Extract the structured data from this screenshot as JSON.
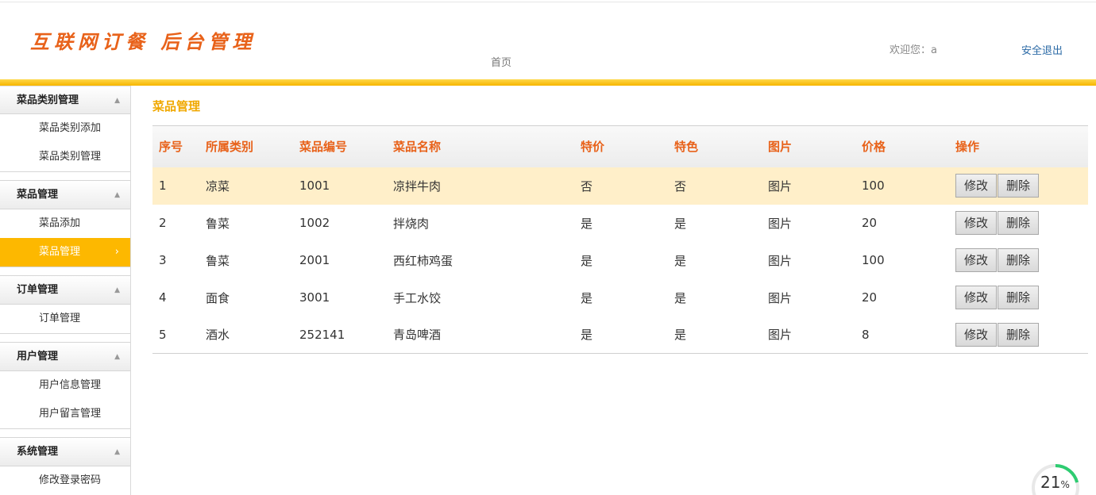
{
  "header": {
    "logo_text": "互联网订餐  后台管理",
    "home_link": "首页",
    "welcome_text": "欢迎您：a",
    "logout_label": "安全退出"
  },
  "sidebar": {
    "groups": [
      {
        "title": "菜品类别管理",
        "items": [
          "菜品类别添加",
          "菜品类别管理"
        ]
      },
      {
        "title": "菜品管理",
        "items": [
          "菜品添加",
          "菜品管理"
        ]
      },
      {
        "title": "订单管理",
        "items": [
          "订单管理"
        ]
      },
      {
        "title": "用户管理",
        "items": [
          "用户信息管理",
          "用户留言管理"
        ]
      },
      {
        "title": "系统管理",
        "items": [
          "修改登录密码"
        ]
      }
    ],
    "active_item": "菜品管理"
  },
  "main": {
    "title": "菜品管理",
    "columns": [
      "序号",
      "所属类别",
      "菜品编号",
      "菜品名称",
      "特价",
      "特色",
      "图片",
      "价格",
      "操作"
    ],
    "rows": [
      {
        "no": "1",
        "category": "凉菜",
        "code": "1001",
        "name": "凉拌牛肉",
        "special_price": "否",
        "featured": "否",
        "image": "图片",
        "price": "100"
      },
      {
        "no": "2",
        "category": "鲁菜",
        "code": "1002",
        "name": "拌烧肉",
        "special_price": "是",
        "featured": "是",
        "image": "图片",
        "price": "20"
      },
      {
        "no": "3",
        "category": "鲁菜",
        "code": "2001",
        "name": "西红柿鸡蛋",
        "special_price": "是",
        "featured": "是",
        "image": "图片",
        "price": "100"
      },
      {
        "no": "4",
        "category": "面食",
        "code": "3001",
        "name": "手工水饺",
        "special_price": "是",
        "featured": "是",
        "image": "图片",
        "price": "20"
      },
      {
        "no": "5",
        "category": "酒水",
        "code": "252141",
        "name": "青岛啤酒",
        "special_price": "是",
        "featured": "是",
        "image": "图片",
        "price": "8"
      }
    ],
    "edit_label": "修改",
    "delete_label": "删除"
  },
  "progress": {
    "value": "21",
    "unit": "%",
    "fraction": 0.21,
    "color": "#2ecc71"
  },
  "colors": {
    "accent": "#fdb800",
    "header_text": "#e8621a",
    "title": "#f0a800",
    "link": "#2b6aa6",
    "row_highlight": "#ffefc9"
  }
}
